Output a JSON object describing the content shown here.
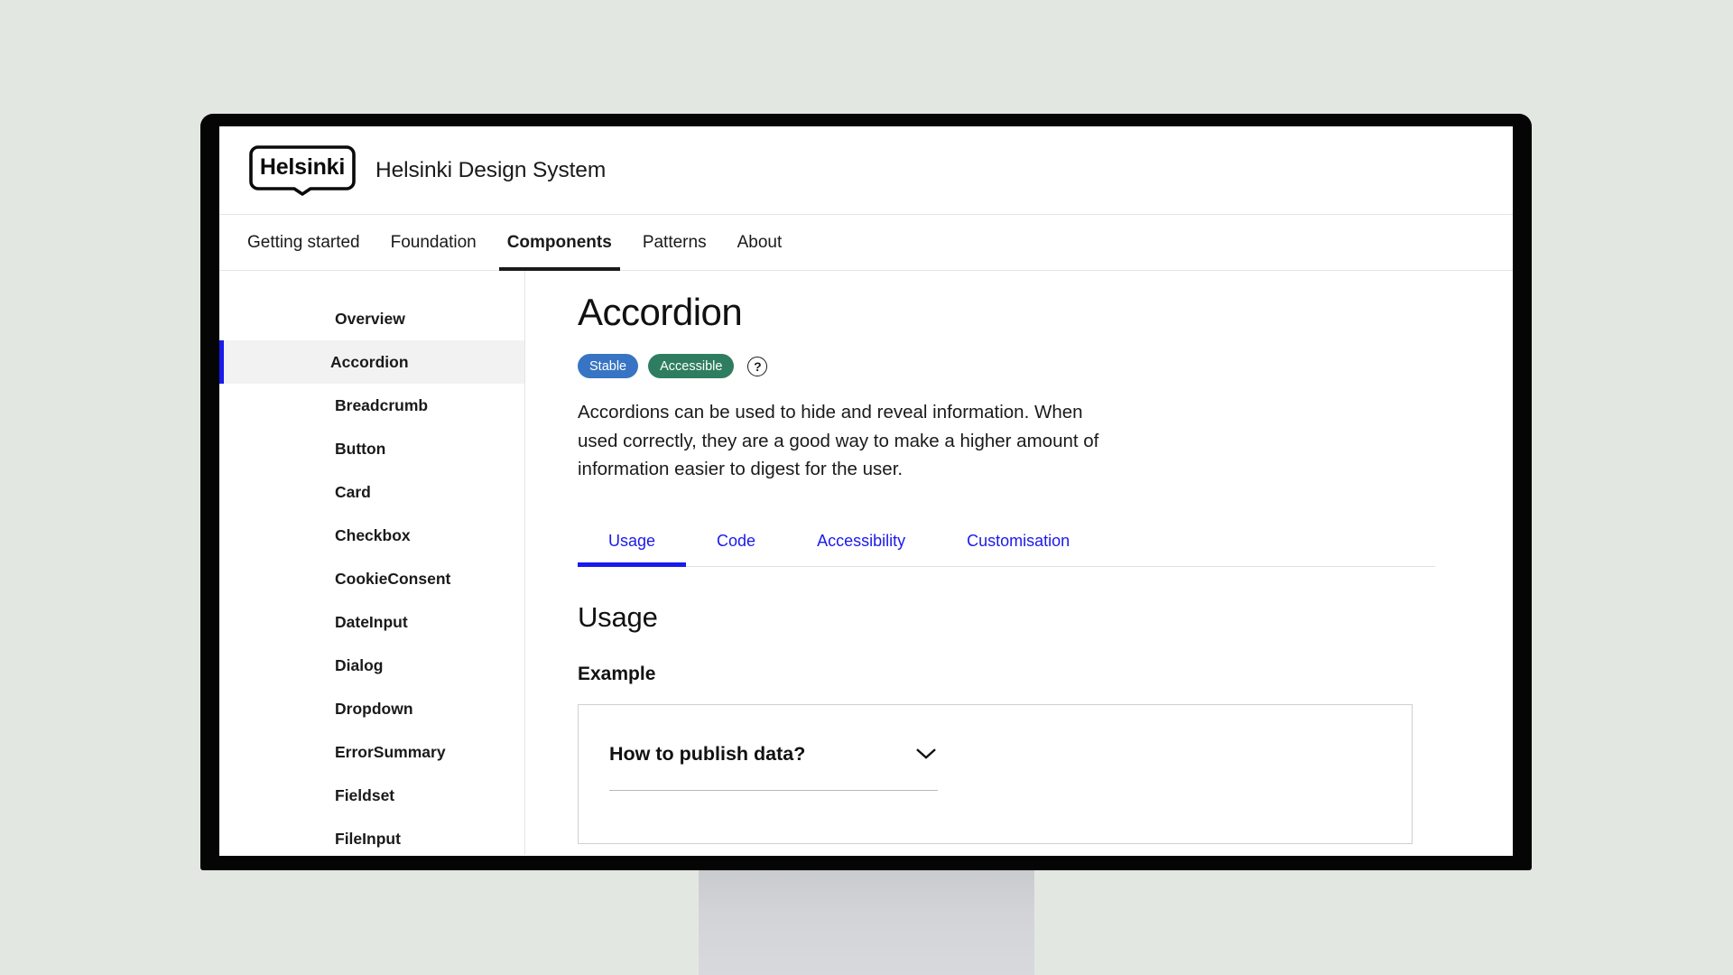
{
  "header": {
    "logo_text": "Helsinki",
    "logo_icon": "helsinki-shield-icon",
    "site_title": "Helsinki Design System"
  },
  "main_nav": {
    "items": [
      {
        "label": "Getting started",
        "active": false
      },
      {
        "label": "Foundation",
        "active": false
      },
      {
        "label": "Components",
        "active": true
      },
      {
        "label": "Patterns",
        "active": false
      },
      {
        "label": "About",
        "active": false
      }
    ]
  },
  "sidebar": {
    "items": [
      {
        "label": "Overview",
        "active": false
      },
      {
        "label": "Accordion",
        "active": true
      },
      {
        "label": "Breadcrumb",
        "active": false
      },
      {
        "label": "Button",
        "active": false
      },
      {
        "label": "Card",
        "active": false
      },
      {
        "label": "Checkbox",
        "active": false
      },
      {
        "label": "CookieConsent",
        "active": false
      },
      {
        "label": "DateInput",
        "active": false
      },
      {
        "label": "Dialog",
        "active": false
      },
      {
        "label": "Dropdown",
        "active": false
      },
      {
        "label": "ErrorSummary",
        "active": false
      },
      {
        "label": "Fieldset",
        "active": false
      },
      {
        "label": "FileInput",
        "active": false
      }
    ]
  },
  "content": {
    "page_title": "Accordion",
    "badges": [
      {
        "label": "Stable",
        "color": "#3874c4"
      },
      {
        "label": "Accessible",
        "color": "#2f7d60"
      }
    ],
    "help_icon": "question-mark-circle-icon",
    "help_glyph": "?",
    "lede": "Accordions can be used to hide and reveal information. When used correctly, they are a good way to make a higher amount of information easier to digest for the user.",
    "tabs": [
      {
        "label": "Usage",
        "active": true
      },
      {
        "label": "Code",
        "active": false
      },
      {
        "label": "Accessibility",
        "active": false
      },
      {
        "label": "Customisation",
        "active": false
      }
    ],
    "section_title": "Usage",
    "subsection_title": "Example",
    "example": {
      "accordion_label": "How to publish data?",
      "chevron_icon": "chevron-down-icon"
    }
  },
  "theme": {
    "page_background": "#e3e7e1",
    "accent_blue": "#1a1aeb",
    "bezel": "#050505",
    "active_sidebar_bg": "#f2f2f3"
  }
}
